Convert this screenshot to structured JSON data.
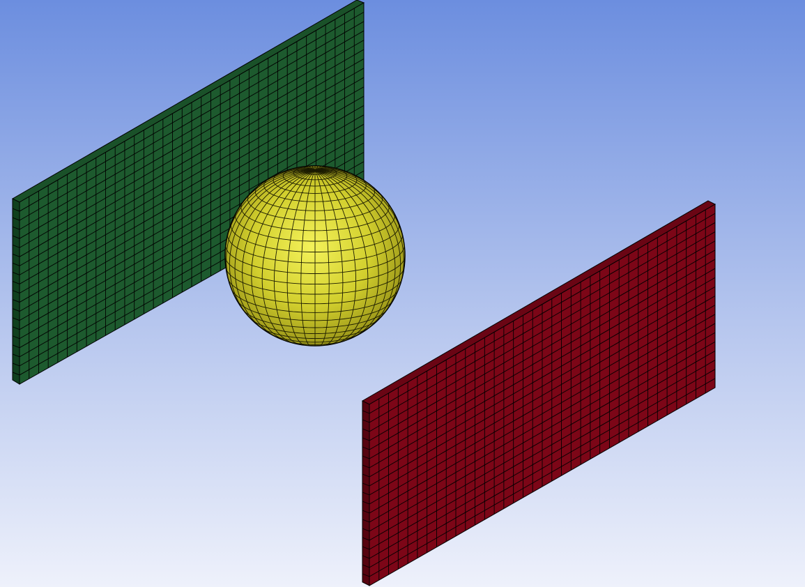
{
  "viewport": {
    "background_top": "#6c8edf",
    "background_bottom": "#eef1fb"
  },
  "bodies": [
    {
      "name": "green-plate",
      "color": "#1d5a2e",
      "mesh_divisions": [
        36,
        20
      ]
    },
    {
      "name": "sphere",
      "color": "#d8d83a",
      "shading": "yellow"
    },
    {
      "name": "red-plate",
      "color": "#7c0617",
      "mesh_divisions": [
        36,
        20
      ]
    }
  ]
}
